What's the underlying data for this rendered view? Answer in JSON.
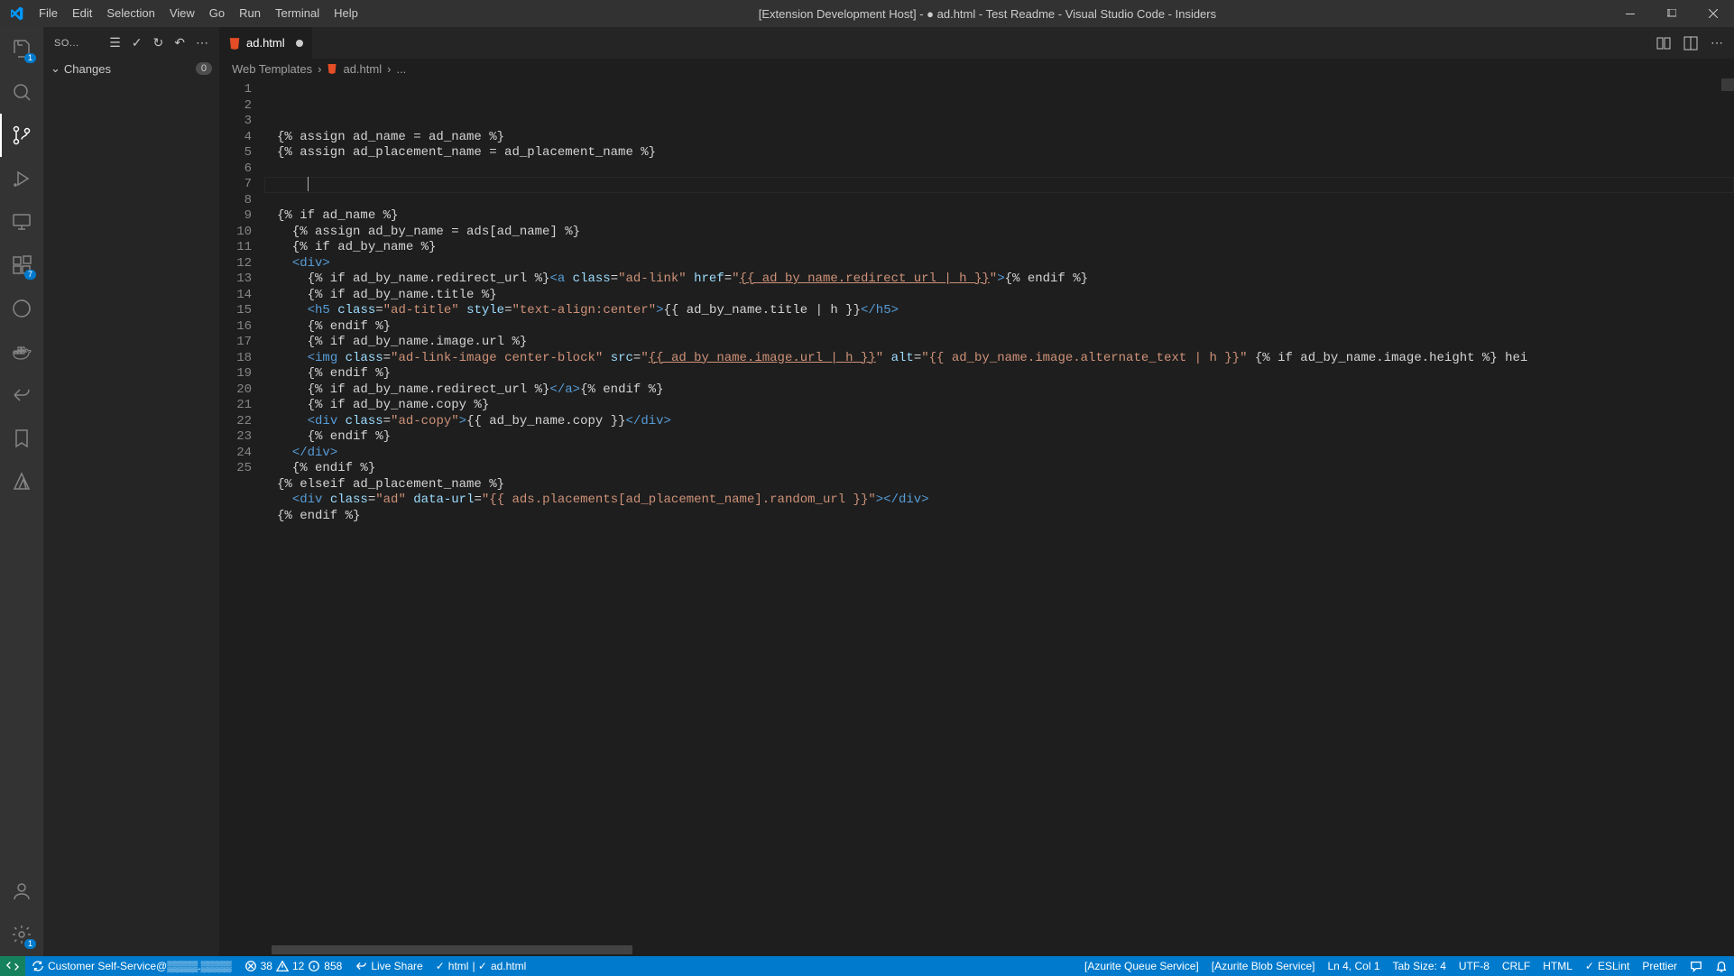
{
  "titlebar": {
    "menus": [
      "File",
      "Edit",
      "Selection",
      "View",
      "Go",
      "Run",
      "Terminal",
      "Help"
    ],
    "title": "[Extension Development Host] - ● ad.html - Test Readme - Visual Studio Code - Insiders"
  },
  "activitybar": {
    "explorer_badge": "1",
    "extensions_badge": "7",
    "settings_badge": "1"
  },
  "sidebar": {
    "header_label": "SO...",
    "section_label": "Changes",
    "section_count": "0"
  },
  "tabs": {
    "file_icon": "⧉",
    "file_name": "ad.html"
  },
  "breadcrumbs": {
    "seg1": "Web Templates",
    "seg2": "ad.html",
    "seg3": "..."
  },
  "code": {
    "lines": [
      {
        "n": "1",
        "segs": [
          [
            "s-text",
            "{% assign ad_name = ad_name %}"
          ]
        ]
      },
      {
        "n": "2",
        "segs": [
          [
            "s-text",
            "{% assign ad_placement_name = ad_placement_name %}"
          ]
        ]
      },
      {
        "n": "3",
        "segs": []
      },
      {
        "n": "4",
        "segs": [],
        "current": true
      },
      {
        "n": "5",
        "segs": []
      },
      {
        "n": "6",
        "segs": [
          [
            "s-text",
            "{% if ad_name %}"
          ]
        ]
      },
      {
        "n": "7",
        "segs": [
          [
            "s-text",
            "  {% assign ad_by_name = ads[ad_name] %}"
          ]
        ]
      },
      {
        "n": "8",
        "segs": [
          [
            "s-text",
            "  {% if ad_by_name %}"
          ]
        ]
      },
      {
        "n": "9",
        "segs": [
          [
            "s-text",
            "  "
          ],
          [
            "s-tag",
            "<div>"
          ]
        ]
      },
      {
        "n": "10",
        "segs": [
          [
            "s-text",
            "    {% if ad_by_name.redirect_url %}"
          ],
          [
            "s-tag",
            "<a"
          ],
          [
            "s-text",
            " "
          ],
          [
            "s-attr",
            "class"
          ],
          [
            "s-text",
            "="
          ],
          [
            "s-str",
            "\"ad-link\""
          ],
          [
            "s-text",
            " "
          ],
          [
            "s-attr",
            "href"
          ],
          [
            "s-text",
            "="
          ],
          [
            "s-str",
            "\""
          ],
          [
            "s-liqu",
            "{{ ad_by_name.redirect_url | h }}"
          ],
          [
            "s-str",
            "\""
          ],
          [
            "s-tag",
            ">"
          ],
          [
            "s-text",
            "{% endif %}"
          ]
        ]
      },
      {
        "n": "11",
        "segs": [
          [
            "s-text",
            "    {% if ad_by_name.title %}"
          ]
        ]
      },
      {
        "n": "12",
        "segs": [
          [
            "s-text",
            "    "
          ],
          [
            "s-tag",
            "<h5"
          ],
          [
            "s-text",
            " "
          ],
          [
            "s-attr",
            "class"
          ],
          [
            "s-text",
            "="
          ],
          [
            "s-str",
            "\"ad-title\""
          ],
          [
            "s-text",
            " "
          ],
          [
            "s-attr",
            "style"
          ],
          [
            "s-text",
            "="
          ],
          [
            "s-str",
            "\"text-align:center\""
          ],
          [
            "s-tag",
            ">"
          ],
          [
            "s-text",
            "{{ ad_by_name.title | h }}"
          ],
          [
            "s-tag",
            "</h5>"
          ]
        ]
      },
      {
        "n": "13",
        "segs": [
          [
            "s-text",
            "    {% endif %}"
          ]
        ]
      },
      {
        "n": "14",
        "segs": [
          [
            "s-text",
            "    {% if ad_by_name.image.url %}"
          ]
        ]
      },
      {
        "n": "15",
        "segs": [
          [
            "s-text",
            "    "
          ],
          [
            "s-tag",
            "<img"
          ],
          [
            "s-text",
            " "
          ],
          [
            "s-attr",
            "class"
          ],
          [
            "s-text",
            "="
          ],
          [
            "s-str",
            "\"ad-link-image center-block\""
          ],
          [
            "s-text",
            " "
          ],
          [
            "s-attr",
            "src"
          ],
          [
            "s-text",
            "="
          ],
          [
            "s-str",
            "\""
          ],
          [
            "s-liqu",
            "{{ ad_by_name.image.url | h }}"
          ],
          [
            "s-str",
            "\""
          ],
          [
            "s-text",
            " "
          ],
          [
            "s-attr",
            "alt"
          ],
          [
            "s-text",
            "="
          ],
          [
            "s-str",
            "\"{{ ad_by_name.image.alternate_text | h }}\""
          ],
          [
            "s-text",
            " {% if ad_by_name.image.height %} hei"
          ]
        ]
      },
      {
        "n": "16",
        "segs": [
          [
            "s-text",
            "    {% endif %}"
          ]
        ]
      },
      {
        "n": "17",
        "segs": [
          [
            "s-text",
            "    {% if ad_by_name.redirect_url %}"
          ],
          [
            "s-tag",
            "</a>"
          ],
          [
            "s-text",
            "{% endif %}"
          ]
        ]
      },
      {
        "n": "18",
        "segs": [
          [
            "s-text",
            "    {% if ad_by_name.copy %}"
          ]
        ]
      },
      {
        "n": "19",
        "segs": [
          [
            "s-text",
            "    "
          ],
          [
            "s-tag",
            "<div"
          ],
          [
            "s-text",
            " "
          ],
          [
            "s-attr",
            "class"
          ],
          [
            "s-text",
            "="
          ],
          [
            "s-str",
            "\"ad-copy\""
          ],
          [
            "s-tag",
            ">"
          ],
          [
            "s-text",
            "{{ ad_by_name.copy }}"
          ],
          [
            "s-tag",
            "</div>"
          ]
        ]
      },
      {
        "n": "20",
        "segs": [
          [
            "s-text",
            "    {% endif %}"
          ]
        ]
      },
      {
        "n": "21",
        "segs": [
          [
            "s-text",
            "  "
          ],
          [
            "s-tag",
            "</div>"
          ]
        ]
      },
      {
        "n": "22",
        "segs": [
          [
            "s-text",
            "  {% endif %}"
          ]
        ]
      },
      {
        "n": "23",
        "segs": [
          [
            "s-text",
            "{% elseif ad_placement_name %}"
          ]
        ]
      },
      {
        "n": "24",
        "segs": [
          [
            "s-text",
            "  "
          ],
          [
            "s-tag",
            "<div"
          ],
          [
            "s-text",
            " "
          ],
          [
            "s-attr",
            "class"
          ],
          [
            "s-text",
            "="
          ],
          [
            "s-str",
            "\"ad\""
          ],
          [
            "s-text",
            " "
          ],
          [
            "s-attr",
            "data-url"
          ],
          [
            "s-text",
            "="
          ],
          [
            "s-str",
            "\"{{ ads.placements[ad_placement_name].random_url }}\""
          ],
          [
            "s-tag",
            "></div>"
          ]
        ]
      },
      {
        "n": "25",
        "segs": [
          [
            "s-text",
            "{% endif %}"
          ]
        ]
      }
    ]
  },
  "statusbar": {
    "remote_text": "Customer Self-Service@▒▒▒▒.▒▒▒▒",
    "errors": "38",
    "warnings": "12",
    "info": "858",
    "live_share": "Live Share",
    "lang_sel": "html",
    "file_sel": "ad.html",
    "azurite_queue": "[Azurite Queue Service]",
    "azurite_blob": "[Azurite Blob Service]",
    "position": "Ln 4, Col 1",
    "tab_size": "Tab Size: 4",
    "encoding": "UTF-8",
    "eol": "CRLF",
    "language": "HTML",
    "eslint": "ESLint",
    "prettier": "Prettier"
  }
}
